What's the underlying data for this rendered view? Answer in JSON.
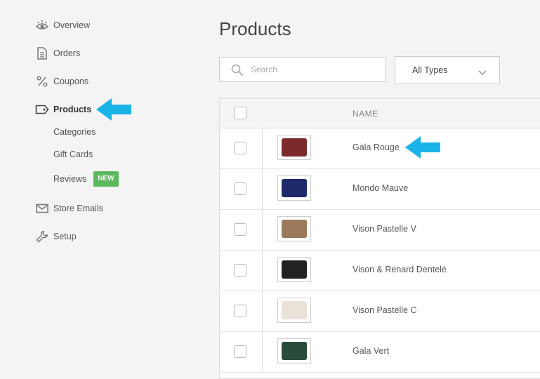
{
  "sidebar": {
    "items": [
      {
        "label": "Overview",
        "icon": "eye-icon"
      },
      {
        "label": "Orders",
        "icon": "document-icon"
      },
      {
        "label": "Coupons",
        "icon": "percent-icon"
      },
      {
        "label": "Products",
        "icon": "tag-icon",
        "active": true
      },
      {
        "label": "Store Emails",
        "icon": "envelope-icon"
      },
      {
        "label": "Setup",
        "icon": "wrench-icon"
      }
    ],
    "sub_items": [
      {
        "label": "Categories"
      },
      {
        "label": "Gift Cards"
      },
      {
        "label": "Reviews",
        "badge": "NEW"
      }
    ]
  },
  "main": {
    "title": "Products",
    "search": {
      "placeholder": "Search",
      "value": ""
    },
    "type_filter": {
      "selected": "All Types"
    },
    "table": {
      "columns": [
        "NAME"
      ],
      "rows": [
        {
          "name": "Gala Rouge",
          "thumb_color": "#7a2a2a"
        },
        {
          "name": "Mondo Mauve",
          "thumb_color": "#1e2a6a"
        },
        {
          "name": "Vison Pastelle V",
          "thumb_color": "#9a7a5a"
        },
        {
          "name": "Vison & Renard Dentelé",
          "thumb_color": "#222222"
        },
        {
          "name": "Vison Pastelle C",
          "thumb_color": "#e8e2d8"
        },
        {
          "name": "Gala Vert",
          "thumb_color": "#2a4a3a"
        }
      ]
    }
  },
  "colors": {
    "accent_arrow": "#1ab3e8",
    "badge_green": "#5cb85c"
  }
}
